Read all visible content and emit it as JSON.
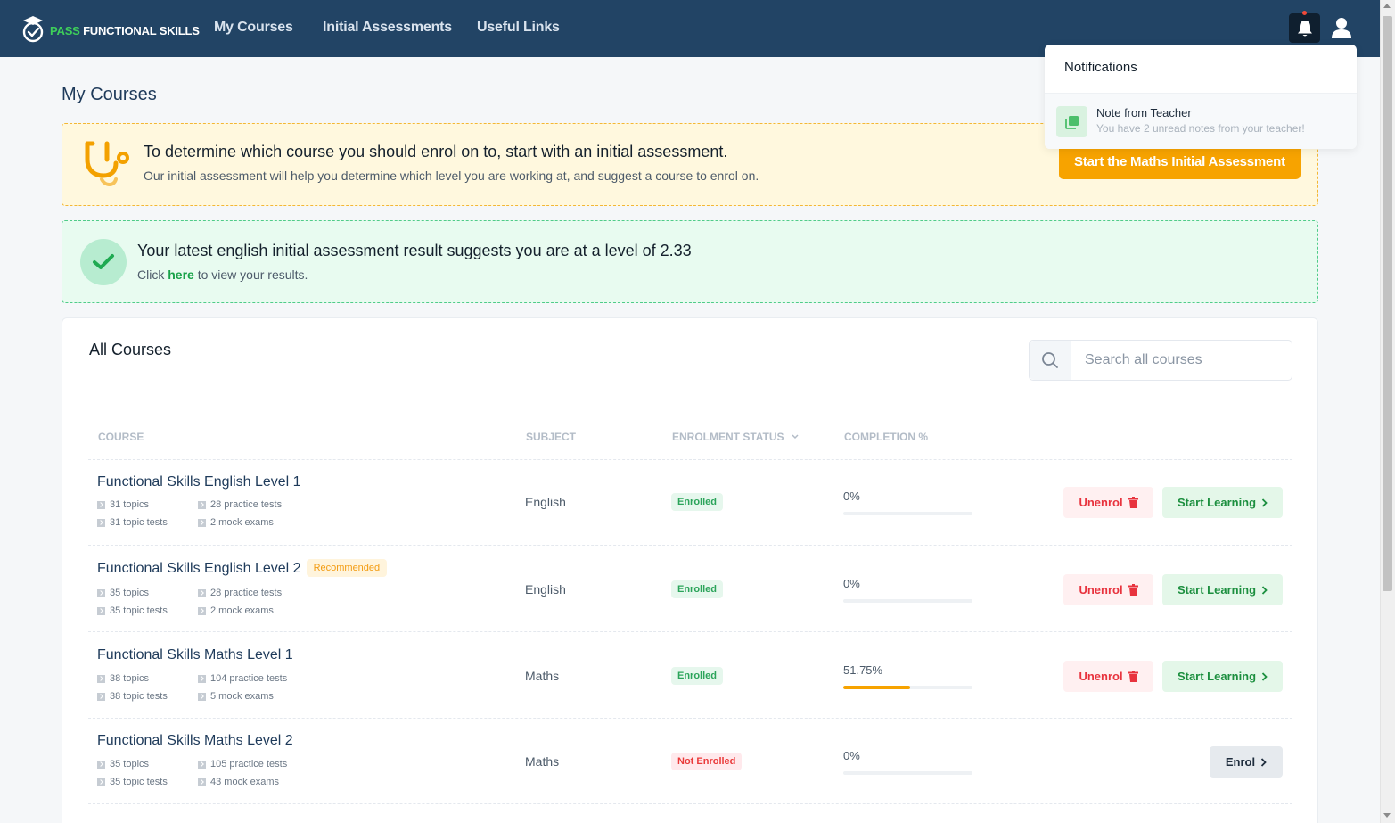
{
  "app": {
    "logo_pass": "PASS",
    "logo_rest": "FUNCTIONAL SKILLS",
    "nav": [
      "My Courses",
      "Initial Assessments",
      "Useful Links"
    ]
  },
  "page_title": "My Courses",
  "assessment_banner": {
    "title": "To determine which course you should enrol on to, start with an initial assessment.",
    "subtitle": "Our initial assessment will help you determine which level you are working at, and suggest a course to enrol on.",
    "button": "Start the Maths Initial Assessment"
  },
  "result_banner": {
    "title": "Your latest english initial assessment result suggests you are at a level of 2.33",
    "sub_before": "Click",
    "sub_link": "here",
    "sub_after": "to view your results."
  },
  "courses_card": {
    "title": "All Courses",
    "search_placeholder": "Search all courses",
    "headers": {
      "course": "COURSE",
      "subject": "SUBJECT",
      "status": "ENROLMENT STATUS",
      "completion": "COMPLETION %"
    }
  },
  "courses": [
    {
      "name": "Functional Skills English Level 1",
      "badge": "",
      "topics": "31 topics",
      "practice": "28 practice tests",
      "topic_tests": "31 topic tests",
      "mocks": "2 mock exams",
      "subject": "English",
      "status": "Enrolled",
      "completion": "0%",
      "completion_fraction": 0,
      "unenrol": "Unenrol",
      "action": "Start Learning"
    },
    {
      "name": "Functional Skills English Level 2",
      "badge": "Recommended",
      "topics": "35 topics",
      "practice": "28 practice tests",
      "topic_tests": "35 topic tests",
      "mocks": "2 mock exams",
      "subject": "English",
      "status": "Enrolled",
      "completion": "0%",
      "completion_fraction": 0,
      "unenrol": "Unenrol",
      "action": "Start Learning"
    },
    {
      "name": "Functional Skills Maths Level 1",
      "badge": "",
      "topics": "38 topics",
      "practice": "104 practice tests",
      "topic_tests": "38 topic tests",
      "mocks": "5 mock exams",
      "subject": "Maths",
      "status": "Enrolled",
      "completion": "51.75%",
      "completion_fraction": 0.5175,
      "unenrol": "Unenrol",
      "action": "Start Learning"
    },
    {
      "name": "Functional Skills Maths Level 2",
      "badge": "",
      "topics": "35 topics",
      "practice": "105 practice tests",
      "topic_tests": "35 topic tests",
      "mocks": "43 mock exams",
      "subject": "Maths",
      "status": "Not Enrolled",
      "completion": "0%",
      "completion_fraction": 0,
      "unenrol": "",
      "action": "Enrol"
    }
  ],
  "notifications": {
    "title": "Notifications",
    "items": [
      {
        "title": "Note from Teacher",
        "body": "You have 2 unread notes from your teacher!"
      }
    ]
  },
  "colors": {
    "nav_bg": "#224465",
    "accent_orange": "#f7a300",
    "success_green": "#1aa34a",
    "danger_red": "#e8333e"
  }
}
